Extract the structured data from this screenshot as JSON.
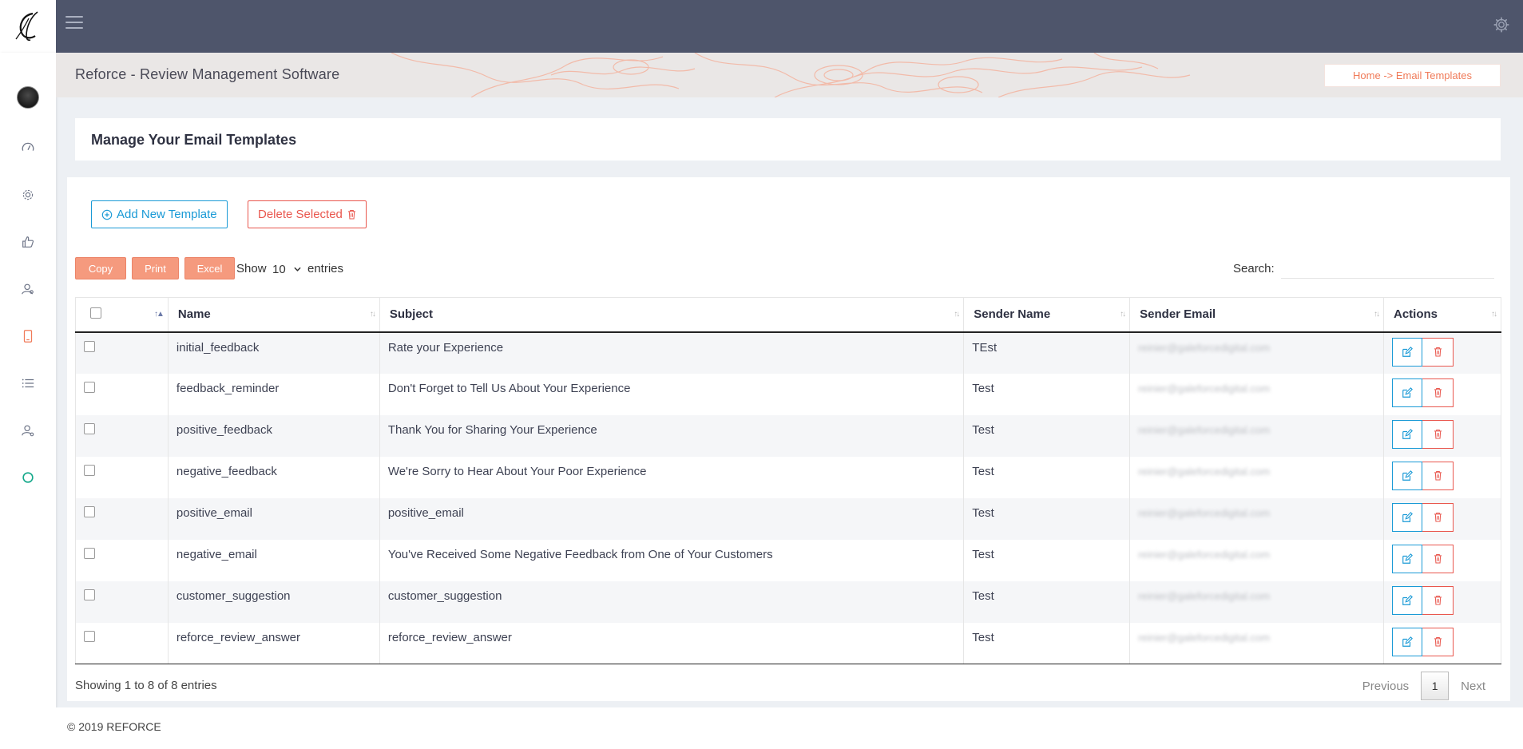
{
  "app": {
    "title": "Reforce - Review Management Software",
    "breadcrumb": "Home -> Email Templates",
    "accent_color": "#f07a58"
  },
  "sidebar": {
    "items": [
      {
        "icon": "avatar"
      },
      {
        "icon": "dashboard-icon"
      },
      {
        "icon": "gear-icon"
      },
      {
        "icon": "thumbs-up-icon"
      },
      {
        "icon": "users-icon"
      },
      {
        "icon": "mobile-icon",
        "active": true
      },
      {
        "icon": "list-icon"
      },
      {
        "icon": "user-settings-icon"
      },
      {
        "icon": "circle-icon"
      }
    ]
  },
  "page": {
    "title": "Manage Your Email Templates"
  },
  "toolbar": {
    "add_label": "Add New Template",
    "delete_label": "Delete Selected",
    "copy_label": "Copy",
    "print_label": "Print",
    "excel_label": "Excel",
    "show_label": "Show",
    "entries_value": "10",
    "entries_label": "entries",
    "search_label": "Search:",
    "search_value": ""
  },
  "table": {
    "columns": [
      "Name",
      "Subject",
      "Sender Name",
      "Sender Email",
      "Actions"
    ],
    "rows": [
      {
        "name": "initial_feedback",
        "subject": "Rate your Experience",
        "sender": "TEst",
        "email": "reinier@galeforcedigital.com"
      },
      {
        "name": "feedback_reminder",
        "subject": "Don't Forget to Tell Us About Your Experience",
        "sender": "Test",
        "email": "reinier@galeforcedigital.com"
      },
      {
        "name": "positive_feedback",
        "subject": "Thank You for Sharing Your Experience",
        "sender": "Test",
        "email": "reinier@galeforcedigital.com"
      },
      {
        "name": "negative_feedback",
        "subject": "We're Sorry to Hear About Your Poor Experience",
        "sender": "Test",
        "email": "reinier@galeforcedigital.com"
      },
      {
        "name": "positive_email",
        "subject": "positive_email",
        "sender": "Test",
        "email": "reinier@galeforcedigital.com"
      },
      {
        "name": "negative_email",
        "subject": "You've Received Some Negative Feedback from One of Your Customers",
        "sender": "Test",
        "email": "reinier@galeforcedigital.com"
      },
      {
        "name": "customer_suggestion",
        "subject": "customer_suggestion",
        "sender": "Test",
        "email": "reinier@galeforcedigital.com"
      },
      {
        "name": "reforce_review_answer",
        "subject": "reforce_review_answer",
        "sender": "Test",
        "email": "reinier@galeforcedigital.com"
      }
    ]
  },
  "pagination": {
    "info": "Showing 1 to 8 of 8 entries",
    "previous": "Previous",
    "current": "1",
    "next": "Next"
  },
  "footer": {
    "text": "© 2019 REFORCE"
  }
}
